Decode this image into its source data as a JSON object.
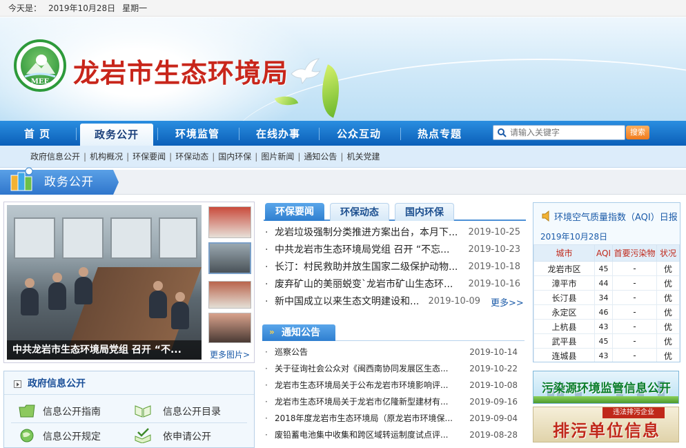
{
  "topbar": {
    "label": "今天是：",
    "date": "2019年10月28日",
    "weekday": "星期一"
  },
  "header": {
    "title": "龙岩市生态环境局",
    "logo_text": "MEE"
  },
  "nav": {
    "items": [
      "首 页",
      "政务公开",
      "环境监管",
      "在线办事",
      "公众互动",
      "热点专题"
    ],
    "active_index": 1
  },
  "search": {
    "placeholder": "请输入关键字",
    "button_label": "搜索"
  },
  "subnav": {
    "items": [
      "政府信息公开",
      "机构概况",
      "环保要闻",
      "环保动态",
      "国内环保",
      "图片新闻",
      "通知公告",
      "机关党建"
    ]
  },
  "section": {
    "title": "政务公开"
  },
  "slideshow": {
    "caption": "中共龙岩市生态环境局党组 召开 “不...",
    "more_label": "更多图片>"
  },
  "info": {
    "title": "政府信息公开",
    "items": [
      "信息公开指南",
      "信息公开目录",
      "信息公开规定",
      "依申请公开"
    ]
  },
  "news": {
    "tabs": [
      "环保要闻",
      "环保动态",
      "国内环保"
    ],
    "active_tab": 0,
    "items": [
      {
        "title": "龙岩垃圾强制分类推进方案出台，本月下...",
        "date": "2019-10-25"
      },
      {
        "title": "中共龙岩市生态环境局党组 召开 “不忘...",
        "date": "2019-10-23"
      },
      {
        "title": "长汀：村民救助并放生国家二级保护动物...",
        "date": "2019-10-18"
      },
      {
        "title": "废弃矿山的美丽蜕变`龙岩市矿山生态环...",
        "date": "2019-10-16"
      },
      {
        "title": "新中国成立以来生态文明建设和...",
        "date": "2019-10-09"
      }
    ],
    "more_label": "更多>>"
  },
  "notice": {
    "title": "通知公告",
    "items": [
      {
        "title": "巡察公告",
        "date": "2019-10-14"
      },
      {
        "title": "关于征询社会公众对《闽西南协同发展区生态...",
        "date": "2019-10-22"
      },
      {
        "title": "龙岩市生态环境局关于公布龙岩市环境影响评...",
        "date": "2019-10-08"
      },
      {
        "title": "龙岩市生态环境局关于龙岩市亿隆新型建材有...",
        "date": "2019-09-16"
      },
      {
        "title": "2018年度龙岩市生态环境局（原龙岩市环境保...",
        "date": "2019-09-04"
      },
      {
        "title": "废铅蓄电池集中收集和跨区域转运制度试点评...",
        "date": "2019-08-28"
      }
    ]
  },
  "aqi": {
    "title": "环境空气质量指数（AQI）日报",
    "date": "2019年10月28日",
    "headers": [
      "城市",
      "AQI",
      "首要污染物",
      "状况"
    ],
    "rows": [
      {
        "city": "龙岩市区",
        "aqi": "45",
        "pollutant": "-",
        "status": "优"
      },
      {
        "city": "漳平市",
        "aqi": "44",
        "pollutant": "-",
        "status": "优"
      },
      {
        "city": "长汀县",
        "aqi": "34",
        "pollutant": "-",
        "status": "优"
      },
      {
        "city": "永定区",
        "aqi": "46",
        "pollutant": "-",
        "status": "优"
      },
      {
        "city": "上杭县",
        "aqi": "43",
        "pollutant": "-",
        "status": "优"
      },
      {
        "city": "武平县",
        "aqi": "45",
        "pollutant": "-",
        "status": "优"
      },
      {
        "city": "连城县",
        "aqi": "43",
        "pollutant": "-",
        "status": "优"
      }
    ]
  },
  "ads": {
    "monitor_title": "污染源环境监管信息公开",
    "discharge_small": "违法排污企业",
    "discharge_title": "排污单位信息"
  },
  "colors": {
    "brand_red": "#c8261b",
    "nav_blue": "#0b5fb8",
    "link_blue": "#1a5aa8"
  }
}
